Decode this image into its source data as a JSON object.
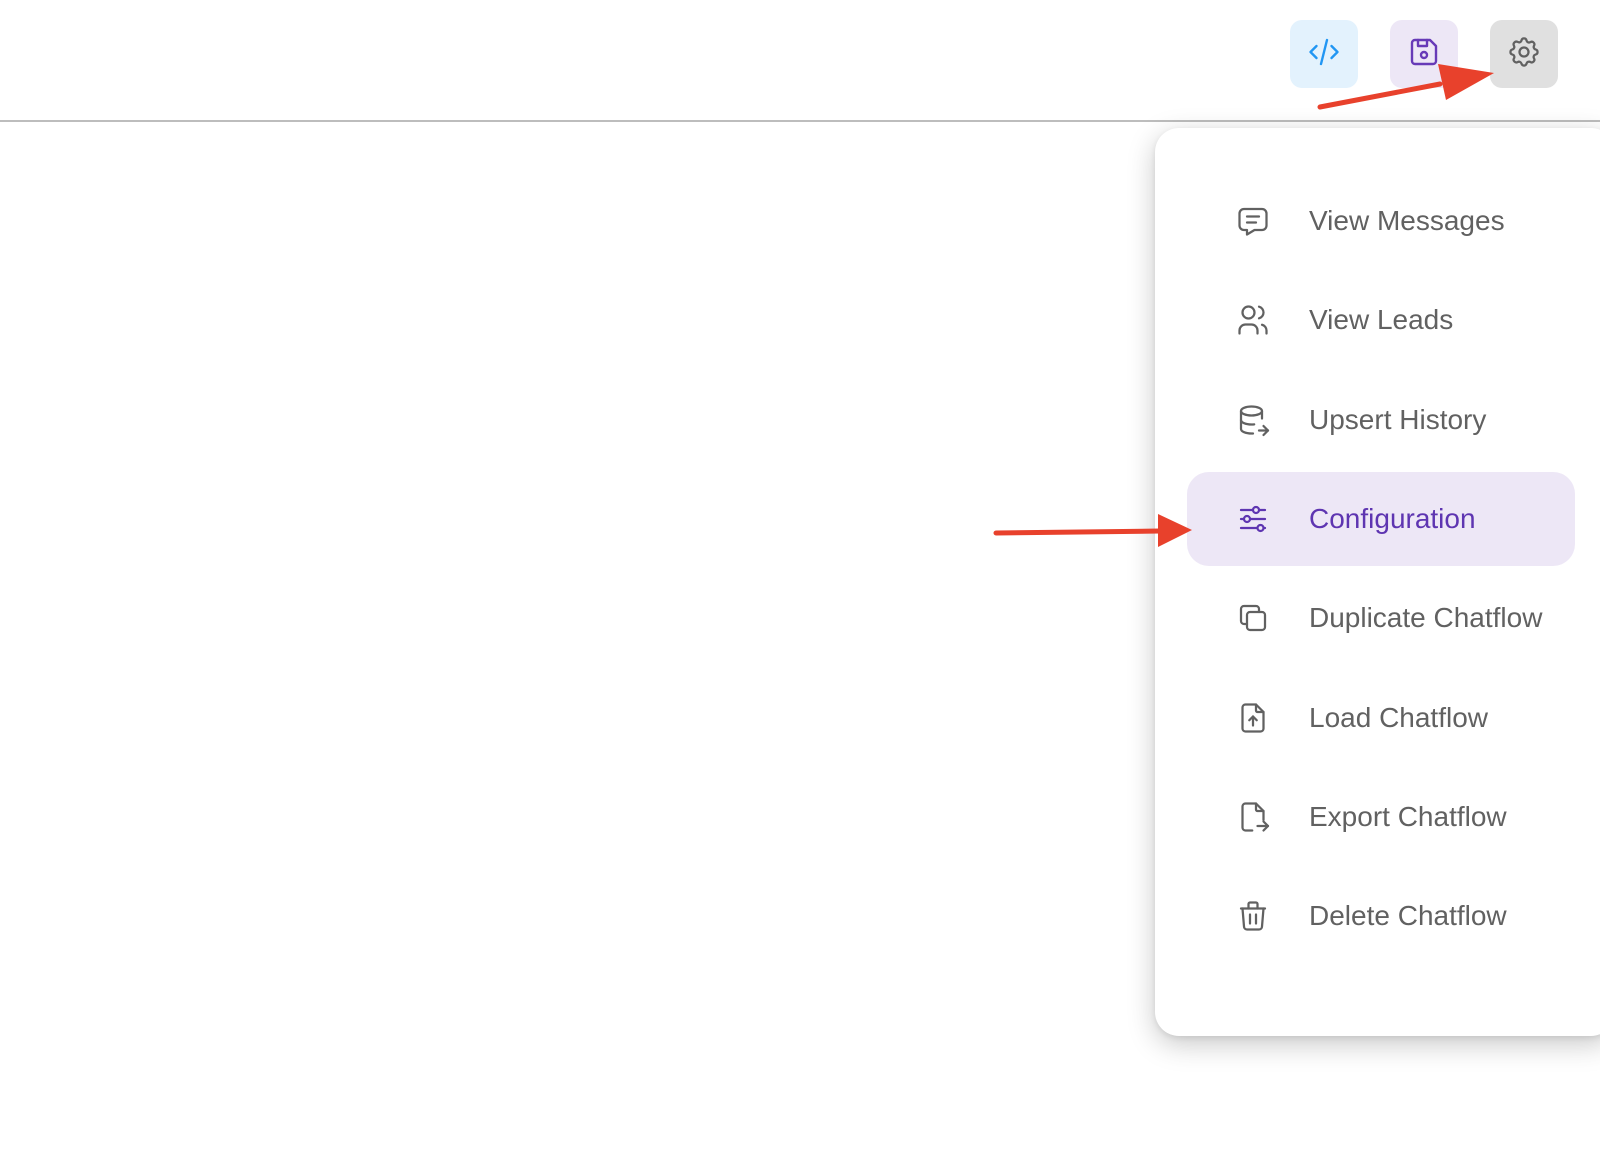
{
  "toolbar": {
    "buttons": [
      {
        "name": "code",
        "icon": "code-icon",
        "color": "#2196f3",
        "bg": "#e3f2fd"
      },
      {
        "name": "save",
        "icon": "save-icon",
        "color": "#673ab7",
        "bg": "#ede7f6"
      },
      {
        "name": "settings",
        "icon": "gear-icon",
        "color": "#616161",
        "bg": "#e0e0e0"
      }
    ]
  },
  "settings_menu": {
    "items": [
      {
        "label": "View Messages",
        "icon": "message-icon"
      },
      {
        "label": "View Leads",
        "icon": "users-icon"
      },
      {
        "label": "Upsert History",
        "icon": "database-export-icon"
      },
      {
        "label": "Configuration",
        "icon": "adjustments-icon",
        "selected": true
      },
      {
        "label": "Duplicate Chatflow",
        "icon": "copy-icon"
      },
      {
        "label": "Load Chatflow",
        "icon": "file-upload-icon"
      },
      {
        "label": "Export Chatflow",
        "icon": "file-export-icon"
      },
      {
        "label": "Delete Chatflow",
        "icon": "trash-icon"
      }
    ],
    "selected_color": "#5e35b1",
    "selected_bg": "#ede7f6"
  },
  "annotations": {
    "arrow_color": "#e8412c",
    "arrows": [
      {
        "points_to": "settings-button"
      },
      {
        "points_to": "menu-item-configuration"
      }
    ]
  }
}
